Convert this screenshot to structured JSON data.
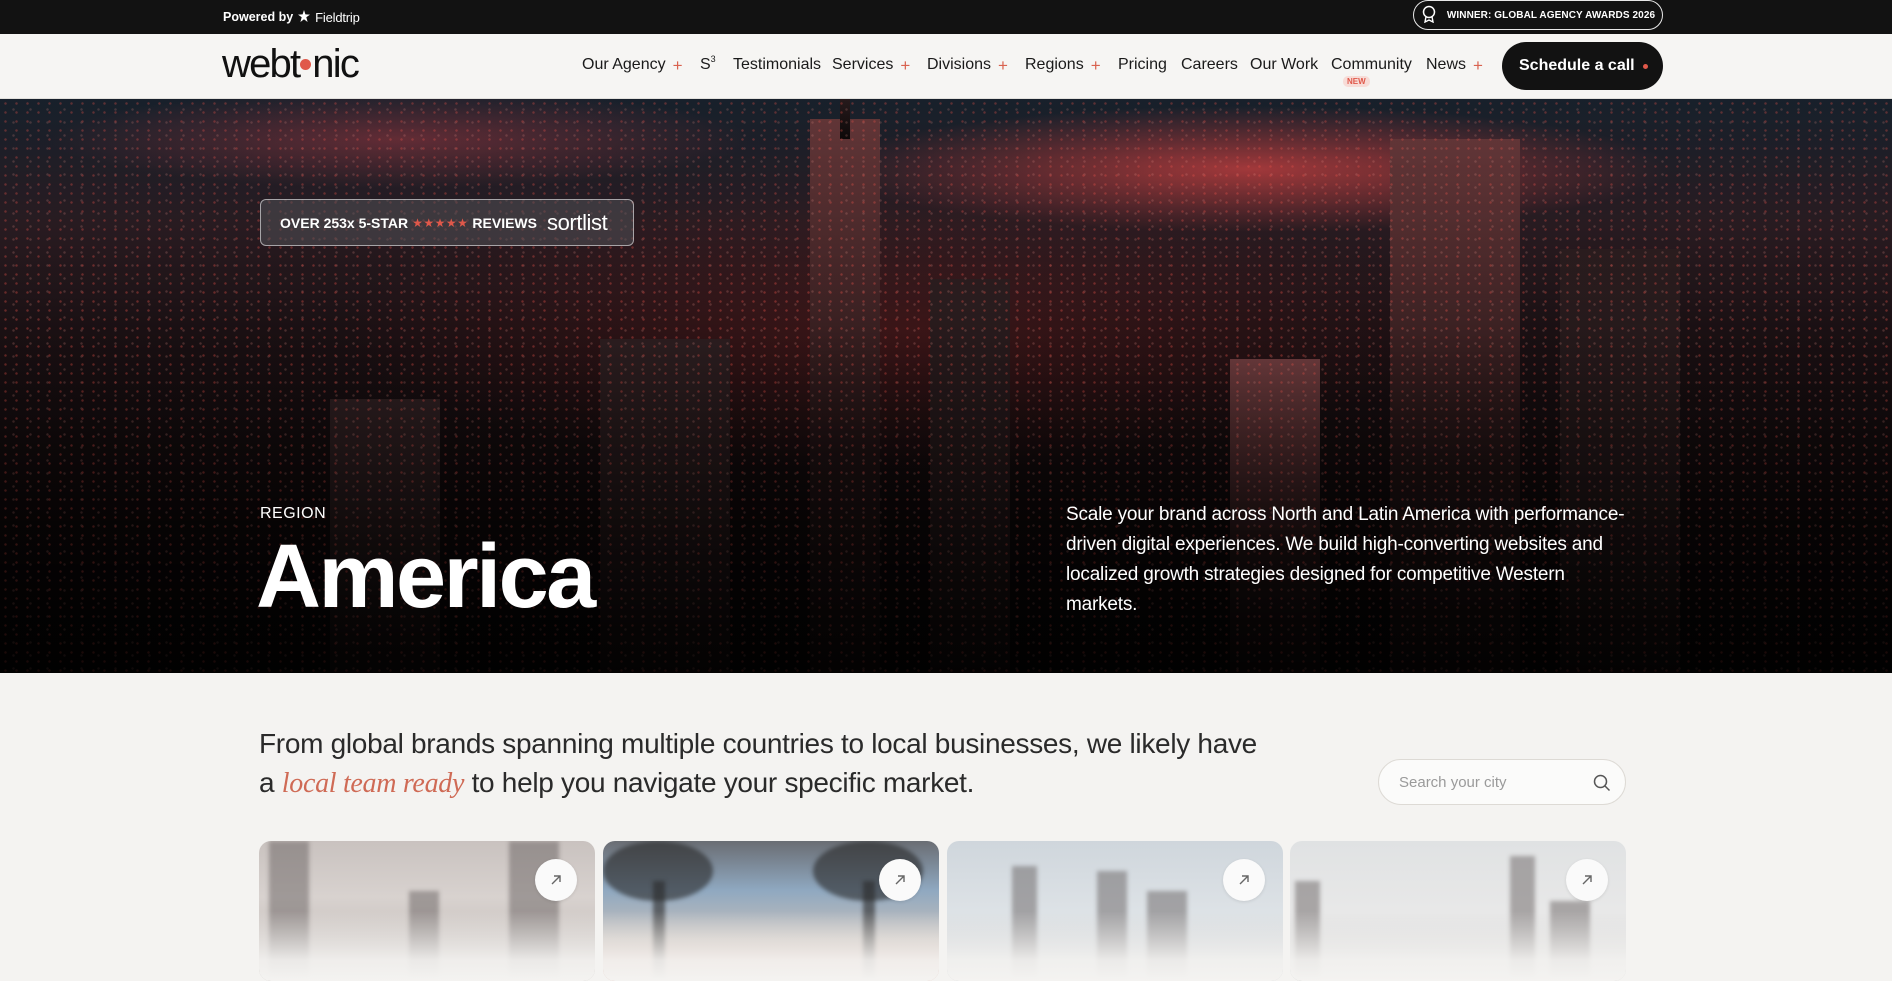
{
  "topbar": {
    "powered_prefix": "Powered by",
    "powered_brand": "Fieldtrip",
    "award": "WINNER: GLOBAL AGENCY AWARDS 2026"
  },
  "header": {
    "logo_left": "webt",
    "logo_right": "nic",
    "nav": [
      {
        "label": "Our Agency",
        "plus": "+"
      },
      {
        "label": "S",
        "sup": "3"
      },
      {
        "label": "Testimonials"
      },
      {
        "label": "Services",
        "plus": "+"
      },
      {
        "label": "Divisions",
        "plus": "+"
      },
      {
        "label": "Regions",
        "plus": "+"
      },
      {
        "label": "Pricing"
      },
      {
        "label": "Careers"
      },
      {
        "label": "Our Work"
      },
      {
        "label": "Community",
        "badge": "NEW"
      },
      {
        "label": "News",
        "plus": "+"
      }
    ],
    "cta": "Schedule a call"
  },
  "hero": {
    "reviews_prefix": "OVER 253x 5-STAR",
    "stars": "★★★★★",
    "reviews_suffix": "REVIEWS",
    "reviews_brand": "sortlist",
    "region_label": "REGION",
    "title": "America",
    "description": "Scale your brand across North and Latin America with performance-driven digital experiences. We build high-converting websites and localized growth strategies designed for competitive Western markets."
  },
  "intro": {
    "before": "From global brands spanning multiple countries to local businesses, we likely have a",
    "highlight": "local team ready",
    "after": "to help you navigate your specific market."
  },
  "search": {
    "placeholder": "Search your city"
  },
  "colors": {
    "accent": "#e0584a",
    "dark": "#121212",
    "background": "#f4f3f1"
  },
  "icons": {
    "award": "award-ribbon-icon",
    "star": "star-icon",
    "search": "search-icon",
    "arrow": "arrow-up-right-icon"
  }
}
